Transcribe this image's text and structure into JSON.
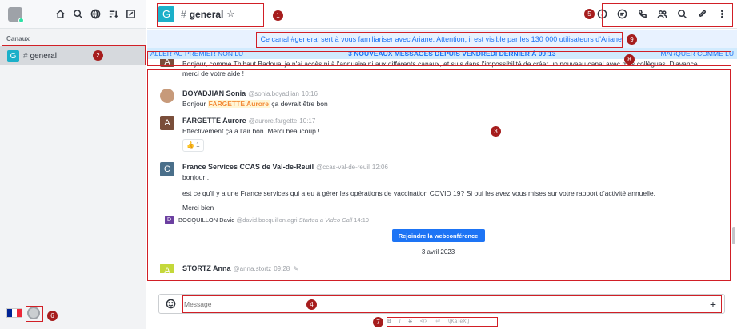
{
  "sidebar": {
    "section_label": "Canaux",
    "channel": {
      "avatar_letter": "G",
      "name": "general"
    },
    "tools": [
      "home-icon",
      "search-icon",
      "globe-icon",
      "sort-icon",
      "edit-icon"
    ]
  },
  "room": {
    "avatar_letter": "G",
    "hash": "#",
    "name": "general",
    "star": "☆",
    "tools": [
      "info-icon",
      "threads-icon",
      "call-icon",
      "members-icon",
      "search-icon",
      "attach-icon",
      "kebab-icon"
    ]
  },
  "announcement": "Ce canal #general sert à vous familiariser avec Ariane. Attention, il est visible par les 130 000 utilisateurs d'Ariane.",
  "unread_bar": {
    "left": "ALLER AU PREMIER NON LU",
    "center": "3 NOUVEAUX MESSAGES DEPUIS VENDREDI DERNIER À 09:13",
    "right": "MARQUER COMME LU"
  },
  "messages": {
    "m0": {
      "avatar": "A",
      "avatar_color": "#7a4e3a",
      "line1": "Bonjour, comme Thibaut Badoual je n'ai accès ni à l'annuaire ni aux différents canaux, et suis dans l'impossibilité de créer un nouveau canal avec mes collègues. D'avance",
      "line2": "merci de votre aide !"
    },
    "m1": {
      "avatar_color": "#c79a7a",
      "name": "BOYADJIAN Sonia",
      "user": "@sonia.boyadjian",
      "time": "10:16",
      "pre": "Bonjour ",
      "mention": "FARGETTE Aurore",
      "post": " ça devrait être bon"
    },
    "m2": {
      "avatar": "A",
      "avatar_color": "#7a4e3a",
      "name": "FARGETTE Aurore",
      "user": "@aurore.fargette",
      "time": "10:17",
      "text": "Effectivement ça a l'air bon. Merci beaucoup !",
      "reaction": "👍 1"
    },
    "m3": {
      "avatar": "C",
      "avatar_color": "#4a6f8a",
      "name": "France Services CCAS de Val-de-Reuil",
      "user": "@ccas-val-de-reuil",
      "time": "12:06",
      "line1": "bonjour ,",
      "line2": "est ce qu'il y a une France services qui a eu à gérer les opérations de vaccination COVID 19? Si oui les avez vous mises sur votre rapport d'activité annuelle.",
      "line3": "Merci bien"
    },
    "sub": {
      "avatar": "D",
      "name": "BOCQUILLON David",
      "user": "@david.bocquillon.agri",
      "action": "Started a Video Call",
      "time": "14:19",
      "button": "Rejoindre la webconférence"
    },
    "date_divider": "3 avril 2023",
    "m4": {
      "avatar": "A",
      "avatar_color": "#c4d83a",
      "name": "STORTZ Anna",
      "user": "@anna.stortz",
      "time": "09:28"
    }
  },
  "composer": {
    "placeholder": "Message",
    "plus": "+"
  },
  "format_bar": [
    "B",
    "I",
    "S",
    "</>",
    "⏎",
    "\\[KaTeX\\]"
  ],
  "annotations": [
    "1",
    "2",
    "3",
    "4",
    "5",
    "6",
    "7",
    "8",
    "9"
  ],
  "accent": "#1d74f5",
  "annotation_color": "#d11f26"
}
